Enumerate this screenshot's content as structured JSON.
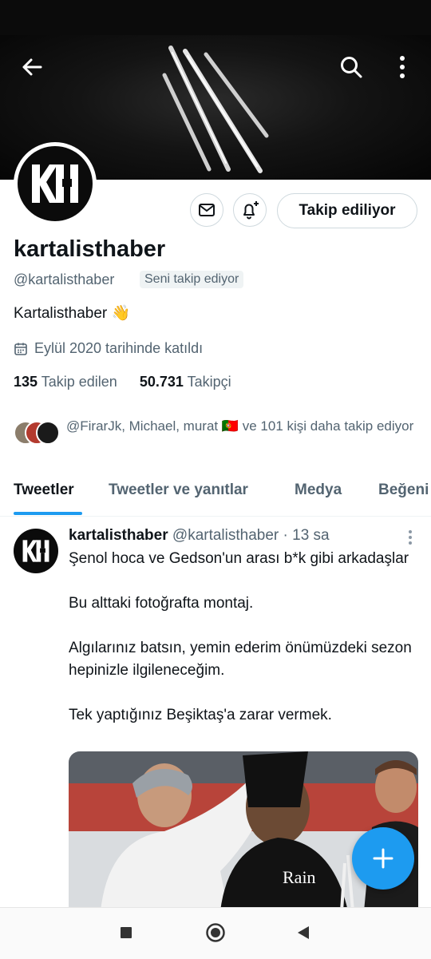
{
  "profile": {
    "name": "kartalisthaber",
    "handle": "@kartalisthaber",
    "follows_you": "Seni takip ediyor",
    "bio": "Kartalisthaber 👋",
    "joined": "Eylül 2020 tarihinde katıldı",
    "following_count": "135",
    "following_label": "Takip edilen",
    "followers_count": "50.731",
    "followers_label": "Takipçi",
    "followed_by": "@FirarJk, Michael, murat 🇵🇹 ve 101 kişi daha takip ediyor",
    "follow_button": "Takip ediliyor",
    "avatar_text": "KH"
  },
  "tabs": [
    "Tweetler",
    "Tweetler ve yanıtlar",
    "Medya",
    "Beğeni"
  ],
  "tweet": {
    "name": "kartalisthaber",
    "handle": "@kartalisthaber",
    "time": "· 13 sa",
    "text": "Şenol hoca ve Gedson'un arası b*k gibi arkadaşlar\n\nBu alttaki fotoğrafta montaj.\n\nAlgılarınız batsın, yemin ederim önümüzdeki sezon hepinizle ilgileneceğim.\n\nTek yaptığınız Beşiktaş'a zarar vermek.",
    "media_sponsor": "Rain"
  },
  "icons": {
    "back": "arrow-left-icon",
    "search": "search-icon",
    "more": "more-vertical-icon",
    "message": "mail-icon",
    "notify": "bell-plus-icon",
    "calendar": "calendar-icon",
    "compose": "plus-icon"
  },
  "colors": {
    "accent": "#1d9bf0",
    "text": "#0f1419",
    "secondary": "#536471"
  }
}
